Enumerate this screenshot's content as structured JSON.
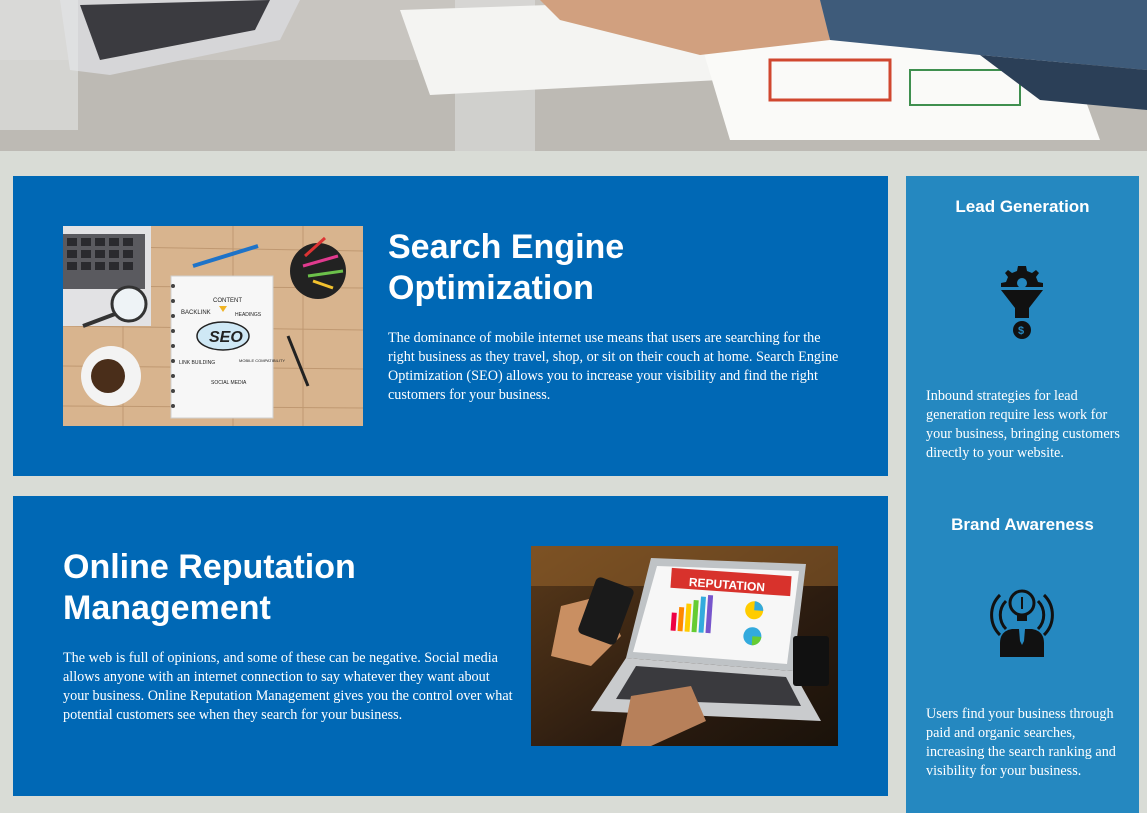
{
  "hero": {
    "image": "office-desk-photo"
  },
  "seo": {
    "title_line1": "Search Engine",
    "title_line2": "Optimization",
    "body": "The dominance of mobile internet use means that users are searching for the right business as they travel, shop, or sit on their couch at home. Search Engine Optimization (SEO) allows you to increase your visibility and find the right customers for your business.",
    "image": {
      "words": [
        "CONTENT",
        "BACKLINK",
        "HEADINGS",
        "SEO",
        "LINK BUILDING",
        "MOBILE COMPATIBILITY",
        "SOCIAL MEDIA"
      ]
    }
  },
  "orm": {
    "title_line1": "Online Reputation",
    "title_line2": "Management",
    "body": "The web is full of opinions, and some of these can be negative. Social media allows anyone with an internet connection to say whatever they want about your business. Online Reputation Management gives you the control over what potential customers see when they search for your business.",
    "image": {
      "screen_label": "REPUTATION"
    }
  },
  "sidebar": {
    "lead": {
      "heading": "Lead Generation",
      "icon": "funnel-gear-dollar-icon",
      "text": "Inbound strategies for lead generation require less work for your business, bringing customers directly to your website."
    },
    "brand": {
      "heading": "Brand Awareness",
      "icon": "lightbulb-person-icon",
      "text": "Users find your business through paid and organic searches, increasing the search ranking and visibility for your business."
    }
  },
  "colors": {
    "card_blue": "#0068b5",
    "sidebar_blue": "#2588c0",
    "page_bg": "#d9dcd6"
  }
}
